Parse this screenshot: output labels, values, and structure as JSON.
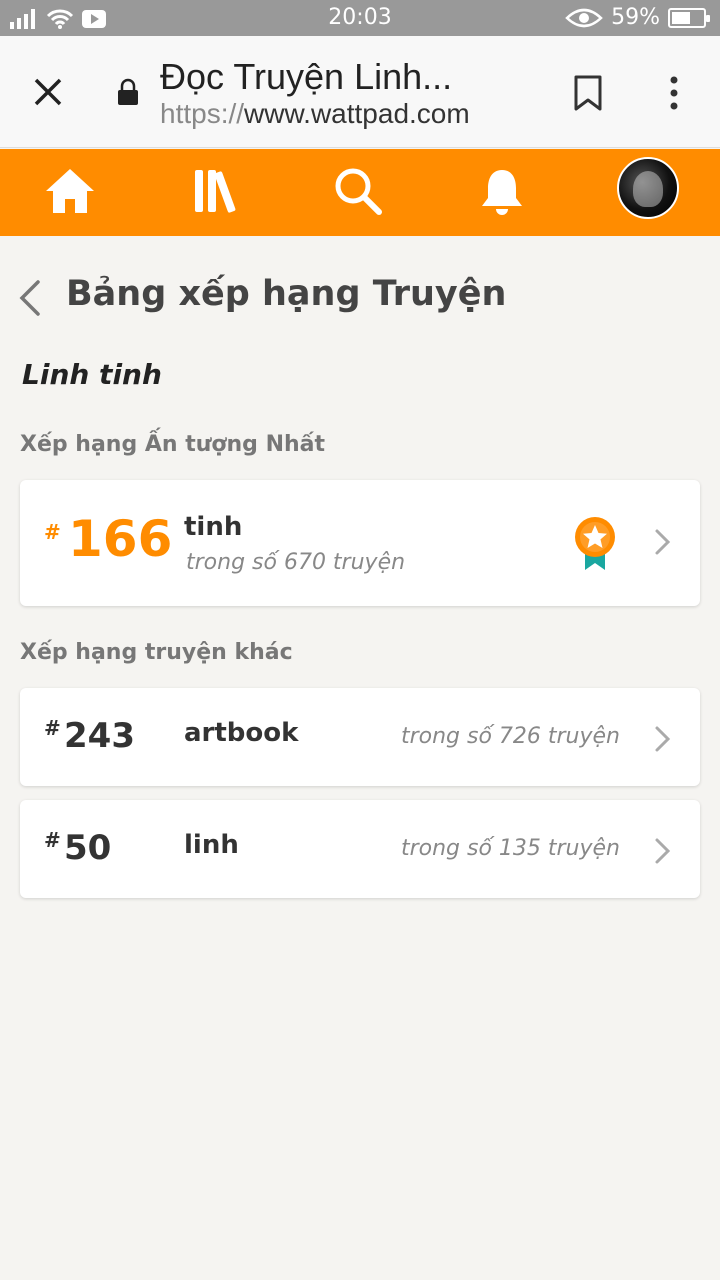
{
  "status_bar": {
    "time": "20:03",
    "battery": "59%",
    "battery_level": 0.59
  },
  "browser": {
    "title": "Đọc Truyện Linh...",
    "url_scheme": "https://",
    "url_host": "www.wattpad.com"
  },
  "nav": {
    "items": [
      "home-icon",
      "library-icon",
      "search-icon",
      "bell-icon",
      "avatar"
    ]
  },
  "page": {
    "heading": "Bảng xếp hạng Truyện",
    "category": "Linh tinh",
    "featured_label": "Xếp hạng Ấn tượng Nhất",
    "others_label": "Xếp hạng truyện khác"
  },
  "featured": {
    "hash": "#",
    "rank": "166",
    "tag": "tinh",
    "of_text": "trong số 670 truyện"
  },
  "others": [
    {
      "hash": "#",
      "rank": "243",
      "tag": "artbook",
      "of_text": "trong số 726 truyện"
    },
    {
      "hash": "#",
      "rank": "50",
      "tag": "linh",
      "of_text": "trong số 135 truyện"
    }
  ],
  "colors": {
    "accent": "#ff8c00",
    "badge_ribbon": "#1aa7a0"
  }
}
